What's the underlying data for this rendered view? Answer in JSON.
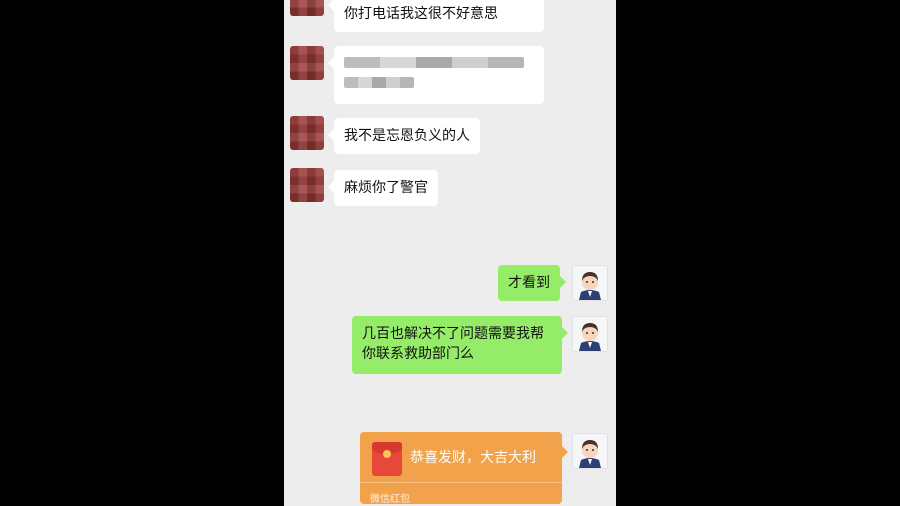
{
  "messages": [
    {
      "side": "left",
      "text": "你打电话我这很不好意思"
    },
    {
      "side": "left",
      "text": "",
      "blurred": true
    },
    {
      "side": "left",
      "text": "我不是忘恩负义的人"
    },
    {
      "side": "left",
      "text": "麻烦你了警官"
    },
    {
      "side": "right",
      "text": "才看到"
    },
    {
      "side": "right",
      "text": "几百也解决不了问题需要我帮你联系救助部门么"
    }
  ],
  "red_packet": {
    "title": "恭喜发财，大吉大利",
    "footer": "微信红包"
  },
  "colors": {
    "chat_bg": "#ededed",
    "bubble_left": "#ffffff",
    "bubble_right": "#95ec69",
    "red_packet": "#f2a24a"
  },
  "icons": {
    "contact_avatar": "pixelated-avatar",
    "officer_avatar": "police-officer-avatar",
    "red_packet": "red-envelope-icon"
  }
}
